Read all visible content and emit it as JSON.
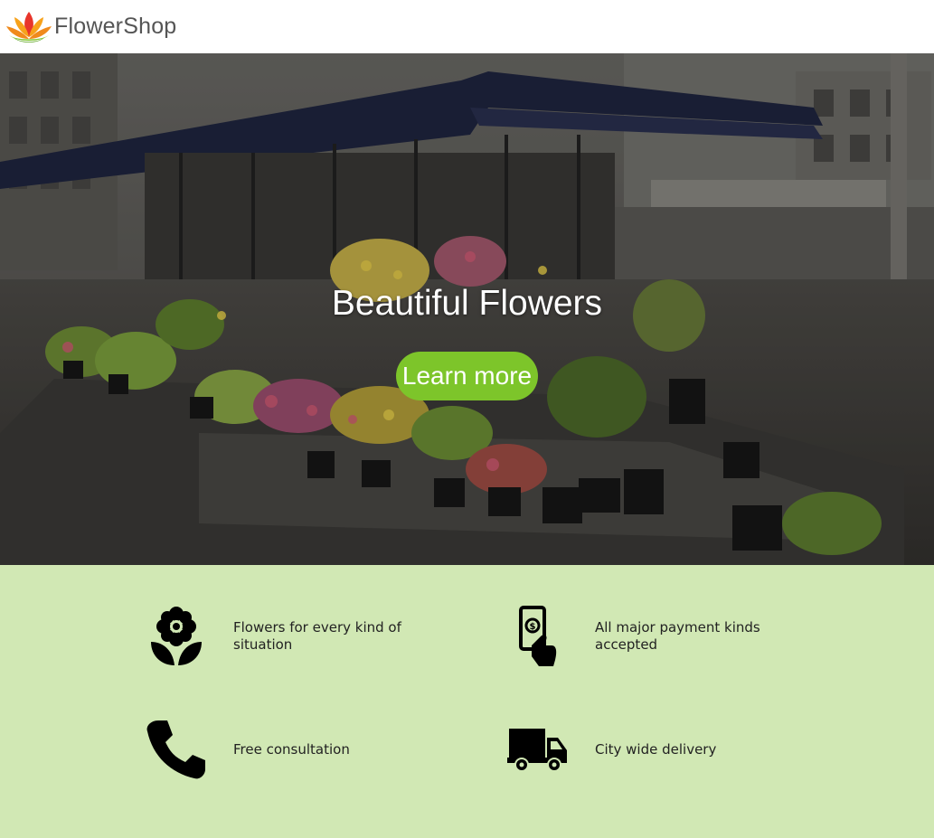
{
  "header": {
    "brand": "FlowerShop",
    "logo_icon": "lotus-flower-logo",
    "brand_colors": [
      "#e8352b",
      "#f7a21b",
      "#7dc52a"
    ]
  },
  "hero": {
    "title": "Beautiful Flowers",
    "cta_label": "Learn more",
    "cta_color": "#7dc52a",
    "background": "flower-market-stall-photo"
  },
  "features": {
    "background_color": "#d1e8b4",
    "items": [
      {
        "icon": "flower-icon",
        "label": "Flowers for every kind of situation"
      },
      {
        "icon": "payment-hand-icon",
        "label": "All major payment kinds accepted"
      },
      {
        "icon": "phone-icon",
        "label": "Free consultation"
      },
      {
        "icon": "truck-icon",
        "label": "City wide delivery"
      }
    ]
  }
}
